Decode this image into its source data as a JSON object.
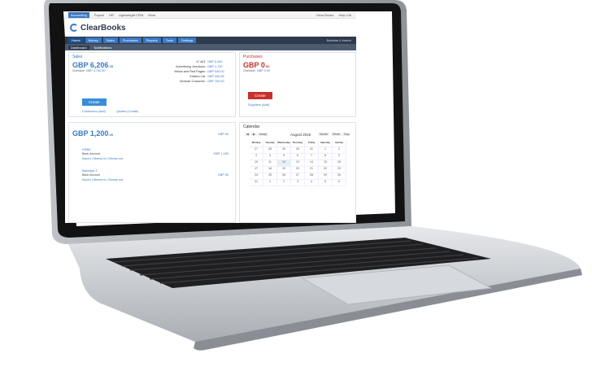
{
  "topbar": {
    "tabs": [
      "Accounting",
      "Payroll",
      "HR",
      "Lightweight CRM",
      "More"
    ],
    "right": [
      "Clear Books",
      "Help Ctrl"
    ]
  },
  "brand": {
    "name": "ClearBooks"
  },
  "nav": {
    "items": [
      "Home",
      "Money",
      "Sales",
      "Purchases",
      "Reports",
      "Tools",
      "Settings"
    ],
    "account": "Business & Invoice"
  },
  "subnav": {
    "items": [
      "Dashboard",
      "Notifications"
    ]
  },
  "help_link": "Need help?",
  "sales": {
    "title": "Sales",
    "amount": "GBP 6,206",
    "amount_minor": ".35",
    "overdue_label": "Overdue:",
    "overdue_value": "GBP 4,700.00",
    "lines": [
      {
        "label": "G VAT:",
        "value": "GBP 5,400"
      },
      {
        "label": "Advertising Junctions:",
        "value": "GBP 1,700"
      },
      {
        "label": "Yellow and Red Pages:",
        "value": "GBP 540.00"
      },
      {
        "label": "Xelsion Ltd:",
        "value": "GBP 426.35"
      },
      {
        "label": "German Customer:",
        "value": "GBP 100.00"
      }
    ],
    "create_label": "Create",
    "customers_link": "Customers (Add)",
    "quotes_link": "Quotes (Create)"
  },
  "purchases": {
    "title": "Purchases",
    "amount": "GBP 0",
    "amount_minor": ".00",
    "overdue_label": "Overdue:",
    "overdue_value": "GBP 0.00",
    "create_label": "Create",
    "suppliers_link": "Suppliers (Add)"
  },
  "bank": {
    "amount": "GBP 1,200",
    "amount_minor": ".00",
    "total_right": "GBP 50",
    "accounts": [
      {
        "name": "HSBC",
        "type": "Bank Account",
        "value": "GBP 1,150",
        "links": "Import | Money in | Money out"
      },
      {
        "name": "Barclays 1",
        "type": "Bank Account",
        "value": "GBP 50",
        "links": "Import | Money in | Money out"
      }
    ]
  },
  "calendar": {
    "title": "Calendar",
    "month": "August 2015",
    "controls": [
      "today",
      "Month",
      "Week",
      "Day"
    ],
    "day_headers": [
      "Monday",
      "Tuesday",
      "Wednesday",
      "Thursday",
      "Friday",
      "Saturday",
      "Sunday"
    ],
    "weeks": [
      [
        "27",
        "28",
        "29",
        "30",
        "31",
        "1",
        "2"
      ],
      [
        "3",
        "4",
        "5",
        "6",
        "7",
        "8",
        "9"
      ],
      [
        "10",
        "11",
        "12",
        "13",
        "14",
        "15",
        "16"
      ],
      [
        "17",
        "18",
        "19",
        "20",
        "21",
        "22",
        "23"
      ],
      [
        "24",
        "25",
        "26",
        "27",
        "28",
        "29",
        "30"
      ],
      [
        "31",
        "1",
        "2",
        "3",
        "4",
        "5",
        "6"
      ]
    ]
  },
  "colors": {
    "accent": "#3a78c3",
    "nav_dark": "#2e3b4e",
    "danger": "#c9302c",
    "laptop_silver": "#c9ccd1",
    "bezel": "#121212"
  }
}
